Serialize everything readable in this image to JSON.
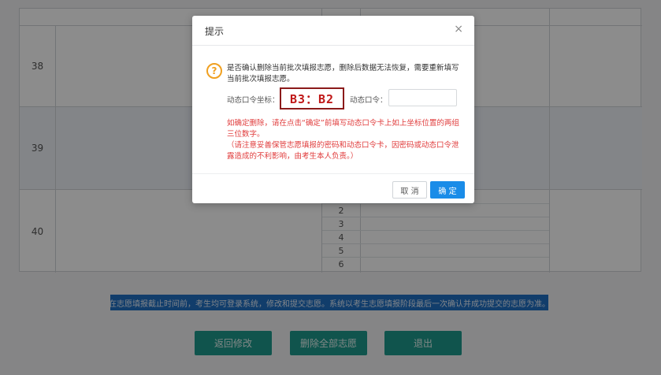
{
  "table": {
    "rows": [
      {
        "number": "38",
        "shaded": false,
        "sub_numbers": []
      },
      {
        "number": "39",
        "shaded": true,
        "sub_numbers": []
      },
      {
        "number": "40",
        "shaded": false,
        "sub_numbers": [
          "2",
          "3",
          "4",
          "5",
          "6"
        ]
      }
    ]
  },
  "notice": {
    "text": "在志愿填报截止时间前，考生均可登录系统，修改和提交志愿。系统以考生志愿填报阶段最后一次确认并成功提交的志愿为准。"
  },
  "bottom_buttons": {
    "back_label": "返回修改",
    "delete_all_label": "删除全部志愿",
    "exit_label": "退出"
  },
  "dialog": {
    "title": "提示",
    "close_symbol": "×",
    "question_symbol": "?",
    "message": "是否确认删除当前批次填报志愿，删除后数据无法恢复，需要重新填写当前批次填报志愿。",
    "coord_label": "动态口令坐标：",
    "coord_value": "B3：B2",
    "pwd_label": "动态口令：",
    "pwd_value": "",
    "warning_line1": "如确定删除，请在点击“确定”前填写动态口令卡上如上坐标位置的两组三位数字。",
    "warning_line2": "（请注意妥善保管志愿填报的密码和动态口令卡，因密码或动态口令泄露造成的不利影响，由考生本人负责。）",
    "cancel_label": "取 消",
    "ok_label": "确 定"
  },
  "colors": {
    "accent": "#1a8ce8",
    "warning": "#e03c3c",
    "notice_bg": "#1f6fc4",
    "teal_button": "#1e9a8c"
  },
  "icons": [
    "close-icon",
    "question-circle-icon"
  ]
}
